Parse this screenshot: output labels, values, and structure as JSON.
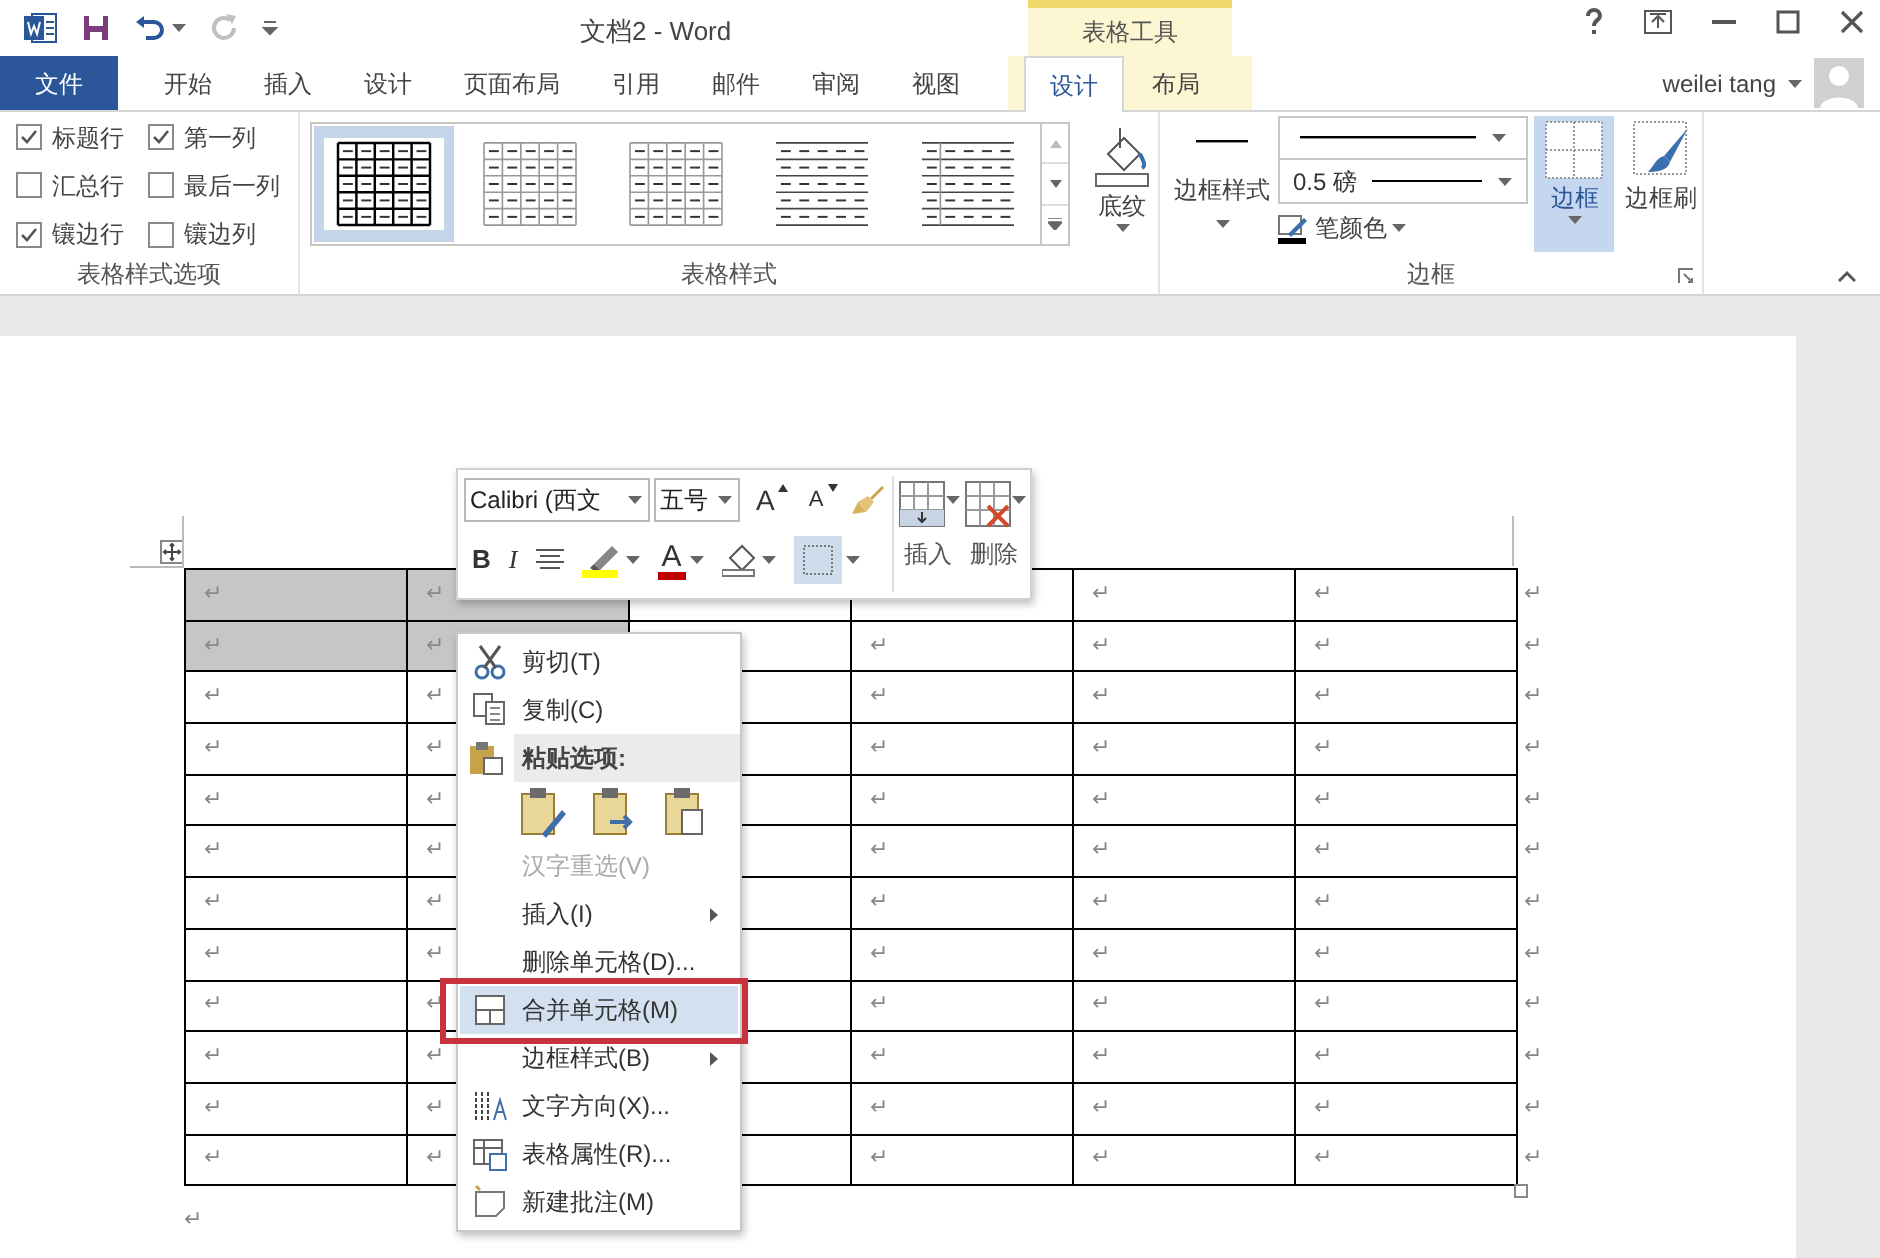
{
  "title_bar": {
    "title": "文档2 - Word",
    "contextual_group": "表格工具",
    "quick_access": [
      {
        "kind": "save",
        "disabled": false
      },
      {
        "kind": "undo",
        "disabled": false
      },
      {
        "kind": "redo",
        "disabled": true
      }
    ]
  },
  "tabs": [
    {
      "label": "文件",
      "kind": "file",
      "selected": false
    },
    {
      "label": "开始",
      "kind": "normal",
      "selected": false
    },
    {
      "label": "插入",
      "kind": "normal",
      "selected": false
    },
    {
      "label": "设计",
      "kind": "normal",
      "selected": false
    },
    {
      "label": "页面布局",
      "kind": "normal",
      "selected": false
    },
    {
      "label": "引用",
      "kind": "normal",
      "selected": false
    },
    {
      "label": "邮件",
      "kind": "normal",
      "selected": false
    },
    {
      "label": "审阅",
      "kind": "normal",
      "selected": false
    },
    {
      "label": "视图",
      "kind": "normal",
      "selected": false
    },
    {
      "label": "设计",
      "kind": "contextual",
      "selected": true
    },
    {
      "label": "布局",
      "kind": "contextual",
      "selected": false
    }
  ],
  "user": {
    "name": "weilei tang"
  },
  "style_options": {
    "label": "表格样式选项",
    "options": [
      {
        "label": "标题行",
        "checked": true
      },
      {
        "label": "第一列",
        "checked": true
      },
      {
        "label": "汇总行",
        "checked": false
      },
      {
        "label": "最后一列",
        "checked": false
      },
      {
        "label": "镶边行",
        "checked": true
      },
      {
        "label": "镶边列",
        "checked": false
      }
    ]
  },
  "table_styles": {
    "label": "表格样式",
    "thumbnails": [
      {
        "kind": "grid-bold",
        "selected": true
      },
      {
        "kind": "grid-light",
        "selected": false
      },
      {
        "kind": "grid-light",
        "selected": false
      },
      {
        "kind": "lines",
        "selected": false
      },
      {
        "kind": "lines-col",
        "selected": false
      }
    ],
    "shading": "底纹"
  },
  "borders": {
    "label": "边框",
    "style_button": "边框样式",
    "weight": "0.5 磅",
    "pen_color": "笔颜色",
    "border_button": {
      "label": "边框",
      "selected": true
    },
    "painter_button": {
      "label": "边框刷",
      "selected": false
    }
  },
  "mini_toolbar": {
    "font": "Calibri (西文",
    "size": "五号",
    "grow": "A",
    "shrink": "A",
    "bold": "B",
    "italic": "I",
    "font_color": "A",
    "borders_selected": true,
    "insert": "插入",
    "delete": "删除"
  },
  "context_menu": [
    {
      "kind": "cut",
      "label": "剪切(T)",
      "disabled": false,
      "submenu": false,
      "selected": false
    },
    {
      "kind": "copy",
      "label": "复制(C)",
      "disabled": false,
      "submenu": false,
      "selected": false
    },
    {
      "kind": "paste-header",
      "label": "粘贴选项:"
    },
    {
      "kind": "paste-icons"
    },
    {
      "kind": "plain",
      "label": "汉字重选(V)",
      "disabled": true,
      "submenu": false,
      "selected": false
    },
    {
      "kind": "plain",
      "label": "插入(I)",
      "disabled": false,
      "submenu": true,
      "selected": false
    },
    {
      "kind": "plain",
      "label": "删除单元格(D)...",
      "disabled": false,
      "submenu": false,
      "selected": false
    },
    {
      "kind": "merge",
      "label": "合并单元格(M)",
      "disabled": false,
      "submenu": false,
      "selected": true
    },
    {
      "kind": "plain",
      "label": "边框样式(B)",
      "disabled": false,
      "submenu": true,
      "selected": false
    },
    {
      "kind": "text-direction",
      "label": "文字方向(X)...",
      "disabled": false,
      "submenu": false,
      "selected": false
    },
    {
      "kind": "table-properties",
      "label": "表格属性(R)...",
      "disabled": false,
      "submenu": false,
      "selected": false
    },
    {
      "kind": "comment",
      "label": "新建批注(M)",
      "disabled": false,
      "submenu": false,
      "selected": false
    }
  ],
  "table": {
    "rows": [
      {
        "cells": [
          {
            "text": "↵",
            "selected": true
          },
          {
            "text": "↵",
            "selected": true
          },
          {
            "selected": false
          },
          {
            "selected": false
          },
          {
            "text": "↵",
            "selected": false
          },
          {
            "text": "↵",
            "selected": false
          }
        ],
        "end": "↵"
      },
      {
        "cells": [
          {
            "text": "↵",
            "selected": true
          },
          {
            "text": "↵",
            "selected": true
          },
          {
            "selected": false
          },
          {
            "text": "↵",
            "selected": false
          },
          {
            "text": "↵",
            "selected": false
          },
          {
            "text": "↵",
            "selected": false
          }
        ],
        "end": "↵"
      },
      {
        "cells": [
          {
            "text": "↵",
            "selected": false
          },
          {
            "text": "↵",
            "selected": false
          },
          {
            "selected": false
          },
          {
            "text": "↵",
            "selected": false
          },
          {
            "text": "↵",
            "selected": false
          },
          {
            "text": "↵",
            "selected": false
          }
        ],
        "end": "↵"
      },
      {
        "cells": [
          {
            "text": "↵",
            "selected": false
          },
          {
            "text": "↵",
            "selected": false
          },
          {
            "selected": false
          },
          {
            "text": "↵",
            "selected": false
          },
          {
            "text": "↵",
            "selected": false
          },
          {
            "text": "↵",
            "selected": false
          }
        ],
        "end": "↵"
      },
      {
        "cells": [
          {
            "text": "↵",
            "selected": false
          },
          {
            "text": "↵",
            "selected": false
          },
          {
            "selected": false
          },
          {
            "text": "↵",
            "selected": false
          },
          {
            "text": "↵",
            "selected": false
          },
          {
            "text": "↵",
            "selected": false
          }
        ],
        "end": "↵"
      },
      {
        "cells": [
          {
            "text": "↵",
            "selected": false
          },
          {
            "text": "↵",
            "selected": false
          },
          {
            "selected": false
          },
          {
            "text": "↵",
            "selected": false
          },
          {
            "text": "↵",
            "selected": false
          },
          {
            "text": "↵",
            "selected": false
          }
        ],
        "end": "↵"
      },
      {
        "cells": [
          {
            "text": "↵",
            "selected": false
          },
          {
            "text": "↵",
            "selected": false
          },
          {
            "selected": false
          },
          {
            "text": "↵",
            "selected": false
          },
          {
            "text": "↵",
            "selected": false
          },
          {
            "text": "↵",
            "selected": false
          }
        ],
        "end": "↵"
      },
      {
        "cells": [
          {
            "text": "↵",
            "selected": false
          },
          {
            "text": "↵",
            "selected": false
          },
          {
            "selected": false
          },
          {
            "text": "↵",
            "selected": false
          },
          {
            "text": "↵",
            "selected": false
          },
          {
            "text": "↵",
            "selected": false
          }
        ],
        "end": "↵"
      },
      {
        "cells": [
          {
            "text": "↵",
            "selected": false
          },
          {
            "text": "↵",
            "selected": false
          },
          {
            "selected": false
          },
          {
            "text": "↵",
            "selected": false
          },
          {
            "text": "↵",
            "selected": false
          },
          {
            "text": "↵",
            "selected": false
          }
        ],
        "end": "↵"
      },
      {
        "cells": [
          {
            "text": "↵",
            "selected": false
          },
          {
            "text": "↵",
            "selected": false
          },
          {
            "selected": false
          },
          {
            "text": "↵",
            "selected": false
          },
          {
            "text": "↵",
            "selected": false
          },
          {
            "text": "↵",
            "selected": false
          }
        ],
        "end": "↵"
      },
      {
        "cells": [
          {
            "text": "↵",
            "selected": false
          },
          {
            "text": "↵",
            "selected": false
          },
          {
            "selected": false
          },
          {
            "text": "↵",
            "selected": false
          },
          {
            "text": "↵",
            "selected": false
          },
          {
            "text": "↵",
            "selected": false
          }
        ],
        "end": "↵"
      },
      {
        "cells": [
          {
            "text": "↵",
            "selected": false
          },
          {
            "text": "↵",
            "selected": false
          },
          {
            "selected": false
          },
          {
            "text": "↵",
            "selected": false
          },
          {
            "text": "↵",
            "selected": false
          },
          {
            "text": "↵",
            "selected": false
          }
        ],
        "end": "↵"
      }
    ],
    "after_mark": "↵"
  }
}
